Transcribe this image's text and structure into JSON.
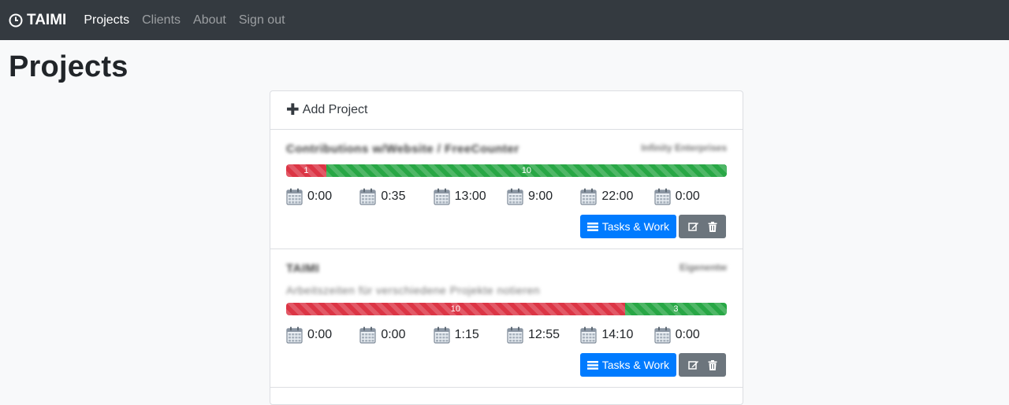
{
  "nav": {
    "brand": "TAIMI",
    "links": [
      "Projects",
      "Clients",
      "About",
      "Sign out"
    ]
  },
  "page": {
    "title": "Projects"
  },
  "card": {
    "add_label": "Add Project",
    "projects": [
      {
        "name": "Contributions w/Website / FreeCounter",
        "client": "Infinity Enterprises",
        "description": "",
        "open_tasks": "1",
        "done_tasks": "10",
        "open_fraction": 0.091,
        "times": [
          "0:00",
          "0:35",
          "13:00",
          "9:00",
          "22:00",
          "0:00"
        ],
        "task_button": "Tasks & Work"
      },
      {
        "name": "TAIMI",
        "client": "Eigenentw",
        "description": "Arbeitszeiten für verschiedene Projekte notieren",
        "open_tasks": "10",
        "done_tasks": "3",
        "open_fraction": 0.769,
        "times": [
          "0:00",
          "0:00",
          "1:15",
          "12:55",
          "14:10",
          "0:00"
        ],
        "task_button": "Tasks & Work"
      }
    ]
  },
  "colors": {
    "navbar": "#343a40",
    "primary": "#007bff",
    "danger": "#dc3545",
    "success": "#28a745",
    "secondary": "#6c757d"
  },
  "icons": [
    "clock-icon",
    "plus-icon",
    "calendar-icon",
    "list-icon",
    "edit-icon",
    "trash-icon"
  ]
}
